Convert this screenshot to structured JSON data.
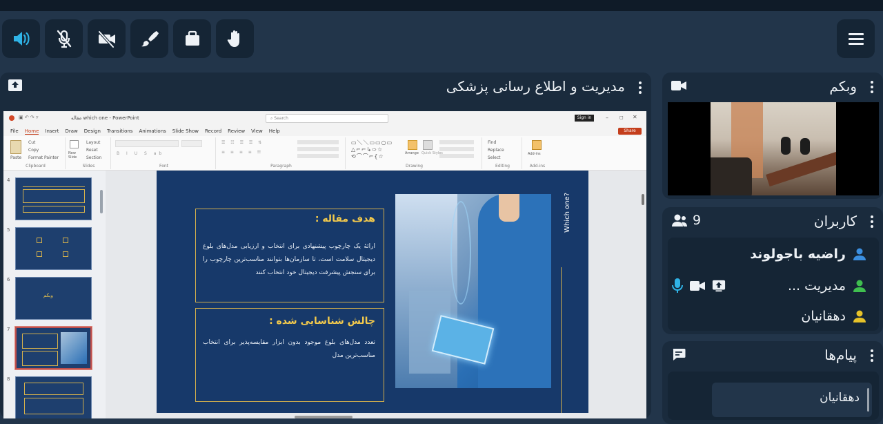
{
  "toolbar": {
    "buttons": [
      {
        "name": "speaker",
        "active": true
      },
      {
        "name": "mic-off",
        "active": false
      },
      {
        "name": "camera-off",
        "active": false
      },
      {
        "name": "brush",
        "active": false
      },
      {
        "name": "case",
        "active": false
      },
      {
        "name": "raise-hand",
        "active": false
      }
    ],
    "menu_icon": "hamburger-icon"
  },
  "presentation": {
    "title": "مدیریت و اطلاع رسانی پزشکی",
    "powerpoint": {
      "window_title": "مقاله which one - PowerPoint",
      "search_placeholder": "Search",
      "sign_in": "Sign in",
      "share": "Share",
      "menu": [
        "File",
        "Home",
        "Insert",
        "Draw",
        "Design",
        "Transitions",
        "Animations",
        "Slide Show",
        "Record",
        "Review",
        "View",
        "Help"
      ],
      "ribbon_groups": [
        "Clipboard",
        "Slides",
        "Font",
        "Paragraph",
        "Drawing",
        "Editing",
        "Add-ins"
      ],
      "clipboard_items": [
        "Paste",
        "Cut",
        "Copy",
        "Format Painter"
      ],
      "slides_items": [
        "New Slide",
        "Layout",
        "Reset",
        "Section"
      ],
      "drawing_items": [
        "Arrange",
        "Quick Styles"
      ],
      "editing_items": [
        "Find",
        "Replace",
        "Select"
      ],
      "addins_item": "Add-ins",
      "thumbnail_numbers": [
        "4",
        "5",
        "6",
        "7",
        "8"
      ],
      "thumb6_text": "وبکم"
    },
    "slide": {
      "box1_heading": "هدف مقاله :",
      "box1_text": "ارائهٔ یک چارچوب پیشنهادی برای انتخاب و ارزیابی مدل‌های بلوغ دیجیتال سلامت است، تا سازمان‌ها بتوانند مناسب‌ترین چارچوب را برای سنجش پیشرفت دیجیتال خود انتخاب کنند",
      "box2_heading": "چالش شناسایی شده :",
      "box2_text": "تعدد مدل‌های بلوغ موجود بدون ابزار مقایسه‌پذیر برای انتخاب مناسب‌ترین مدل",
      "vertical_label": "Which one?"
    }
  },
  "webcam": {
    "title": "وبکم"
  },
  "users": {
    "title": "کاربران",
    "count": "9",
    "list": [
      {
        "name": "راضیه باجولوند",
        "color": "#3b8fe0",
        "bold": true
      },
      {
        "name": "مدیریت ...",
        "color": "#3fbf4f",
        "bold": false
      },
      {
        "name": "دهقانیان",
        "color": "#e6c229",
        "bold": false
      }
    ]
  },
  "messages": {
    "title": "پیام‌ها",
    "first_sender": "دهقانیان"
  },
  "colors": {
    "accent": "#2fb3e6",
    "panel": "#1a2b3d",
    "background": "#22354a",
    "slide_bg": "#17396a",
    "slide_gold": "#d4b04c"
  }
}
